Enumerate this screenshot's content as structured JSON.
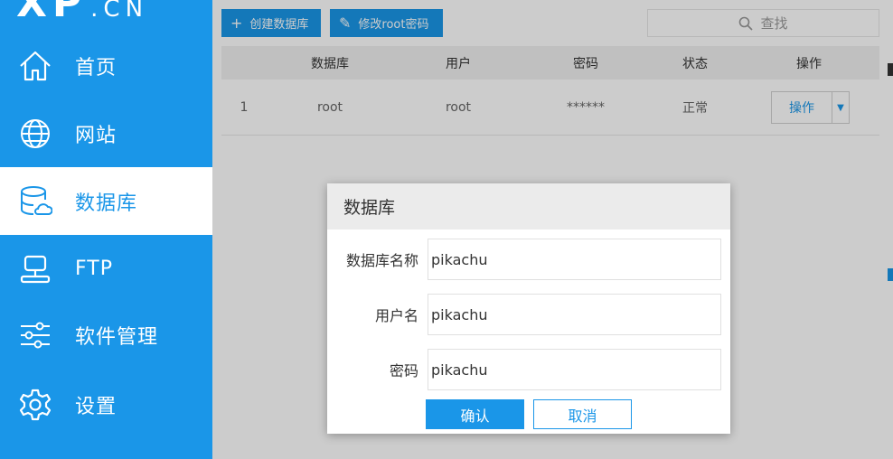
{
  "logo": {
    "main": "XP",
    "suffix": ".CN"
  },
  "sidebar": {
    "items": [
      {
        "label": "首页",
        "icon": "home-icon",
        "active": false
      },
      {
        "label": "网站",
        "icon": "globe-icon",
        "active": false
      },
      {
        "label": "数据库",
        "icon": "database-icon",
        "active": true
      },
      {
        "label": "FTP",
        "icon": "ftp-icon",
        "active": false
      },
      {
        "label": "软件管理",
        "icon": "sliders-icon",
        "active": false
      },
      {
        "label": "设置",
        "icon": "gear-icon",
        "active": false
      }
    ]
  },
  "toolbar": {
    "create_label": "创建数据库",
    "change_root_label": "修改root密码",
    "search_placeholder": "查找"
  },
  "table": {
    "headers": [
      "数据库",
      "用户",
      "密码",
      "状态",
      "操作"
    ],
    "rows": [
      {
        "index": "1",
        "database": "root",
        "user": "root",
        "password": "******",
        "status": "正常",
        "action": "操作"
      }
    ]
  },
  "dialog": {
    "title": "数据库",
    "fields": [
      {
        "label": "数据库名称",
        "value": "pikachu"
      },
      {
        "label": "用户名",
        "value": "pikachu"
      },
      {
        "label": "密码",
        "value": "pikachu"
      }
    ],
    "confirm_label": "确认",
    "cancel_label": "取消"
  },
  "colors": {
    "accent": "#1a96e8",
    "header_bg": "#f0f0f0"
  }
}
